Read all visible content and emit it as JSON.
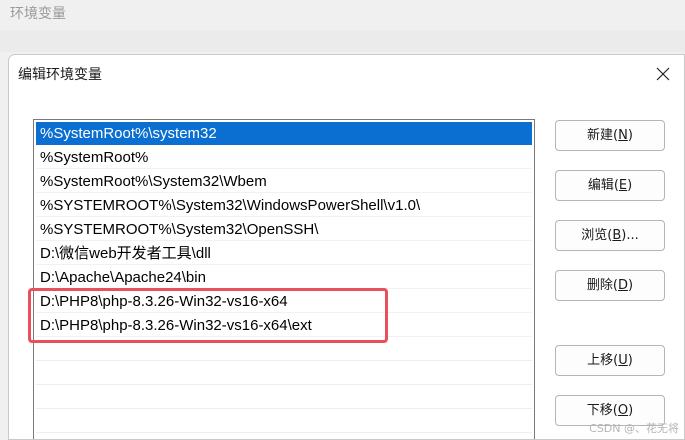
{
  "background_window": {
    "title": "环境变量"
  },
  "dialog": {
    "title": "编辑环境变量",
    "close_icon": "close-icon"
  },
  "path_list": {
    "items": [
      "%SystemRoot%\\system32",
      "%SystemRoot%",
      "%SystemRoot%\\System32\\Wbem",
      "%SYSTEMROOT%\\System32\\WindowsPowerShell\\v1.0\\",
      "%SYSTEMROOT%\\System32\\OpenSSH\\",
      "D:\\微信web开发者工具\\dll",
      "D:\\Apache\\Apache24\\bin",
      "D:\\PHP8\\php-8.3.26-Win32-vs16-x64",
      "D:\\PHP8\\php-8.3.26-Win32-vs16-x64\\ext"
    ],
    "selected_index": 0,
    "highlighted_indices": [
      7,
      8
    ],
    "highlight_color": "#e8505b",
    "selection_color": "#0a6fd0"
  },
  "buttons": {
    "new": {
      "label": "新建(",
      "key": "N",
      "suffix": ")"
    },
    "edit": {
      "label": "编辑(",
      "key": "E",
      "suffix": ")"
    },
    "browse": {
      "label": "浏览(",
      "key": "B",
      "suffix": ")..."
    },
    "delete": {
      "label": "删除(",
      "key": "D",
      "suffix": ")"
    },
    "move_up": {
      "label": "上移(",
      "key": "U",
      "suffix": ")"
    },
    "move_down": {
      "label": "下移(",
      "key": "O",
      "suffix": ")"
    }
  },
  "watermark": "CSDN @、花无将"
}
